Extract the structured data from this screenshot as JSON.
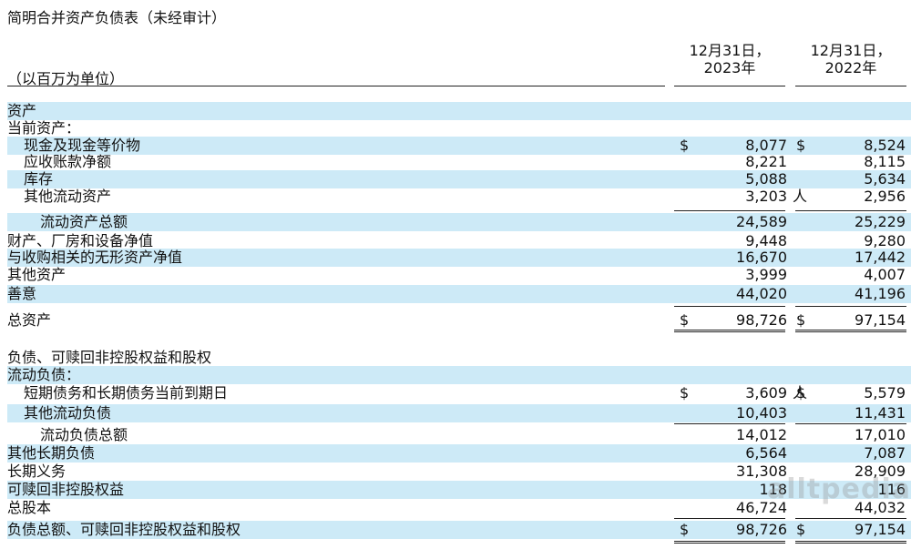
{
  "title": "简明合并资产负债表（未经审计）",
  "unit_label": "（以百万为单位）",
  "columns": [
    "12月31日，\n2023年",
    "12月31日，\n2022年"
  ],
  "columns_lines": [
    [
      "12月31日，",
      "2023年"
    ],
    [
      "12月31日，",
      "2022年"
    ]
  ],
  "rows": [
    {
      "label": "资产",
      "indent": 0,
      "v1": "",
      "v2": "",
      "shade": true
    },
    {
      "label": "当前资产：",
      "indent": 0,
      "v1": "",
      "v2": "",
      "shade": false
    },
    {
      "label": "现金及现金等价物",
      "indent": 1,
      "d1": "$",
      "v1": "8,077",
      "d2": "$",
      "v2": "8,524",
      "shade": true
    },
    {
      "label": "应收账款净额",
      "indent": 1,
      "v1": "8,221",
      "v2": "8,115",
      "shade": false
    },
    {
      "label": "库存",
      "indent": 1,
      "v1": "5,088",
      "v2": "5,634",
      "shade": true
    },
    {
      "label": "其他流动资产",
      "indent": 1,
      "v1": "3,203",
      "s1": "人",
      "v2": "2,956",
      "shade": false
    },
    {
      "label": "流动资产总额",
      "indent": 2,
      "v1": "24,589",
      "v2": "25,229",
      "shade": true
    },
    {
      "label": "财产、厂房和设备净值",
      "indent": 0,
      "v1": "9,448",
      "v2": "9,280",
      "shade": false
    },
    {
      "label": "与收购相关的无形资产净值",
      "indent": 0,
      "v1": "16,670",
      "v2": "17,442",
      "shade": true
    },
    {
      "label": "其他资产",
      "indent": 0,
      "v1": "3,999",
      "v2": "4,007",
      "shade": false
    },
    {
      "label": "善意",
      "indent": 0,
      "v1": "44,020",
      "v2": "41,196",
      "shade": true
    },
    {
      "label": "总资产",
      "indent": 0,
      "d1": "$",
      "v1": "98,726",
      "d2": "$",
      "v2": "97,154",
      "shade": false
    },
    {
      "label": "负债、可赎回非控股权益和股权",
      "indent": 0,
      "v1": "",
      "v2": "",
      "shade": false
    },
    {
      "label": "流动负债：",
      "indent": 0,
      "v1": "",
      "v2": "",
      "shade": true
    },
    {
      "label": "短期债务和长期债务当前到期日",
      "indent": 1,
      "d1": "$",
      "v1": "3,609",
      "s1": "人",
      "d2": "$",
      "v2": "5,579",
      "shade": false
    },
    {
      "label": "其他流动负债",
      "indent": 1,
      "v1": "10,403",
      "v2": "11,431",
      "shade": true
    },
    {
      "label": "流动负债总额",
      "indent": 2,
      "v1": "14,012",
      "v2": "17,010",
      "shade": false
    },
    {
      "label": "其他长期负债",
      "indent": 0,
      "v1": "6,564",
      "v2": "7,087",
      "shade": true
    },
    {
      "label": "长期义务",
      "indent": 0,
      "v1": "31,308",
      "v2": "28,909",
      "shade": false
    },
    {
      "label": "可赎回非控股权益",
      "indent": 0,
      "v1": "118",
      "v2": "116",
      "shade": true
    },
    {
      "label": "总股本",
      "indent": 0,
      "v1": "46,724",
      "v2": "44,032",
      "shade": false
    },
    {
      "label": "负债总额、可赎回非控股权益和股权",
      "indent": 0,
      "d1": "$",
      "v1": "98,726",
      "d2": "$",
      "v2": "97,154",
      "shade": true
    }
  ],
  "watermark": "alltpedia"
}
